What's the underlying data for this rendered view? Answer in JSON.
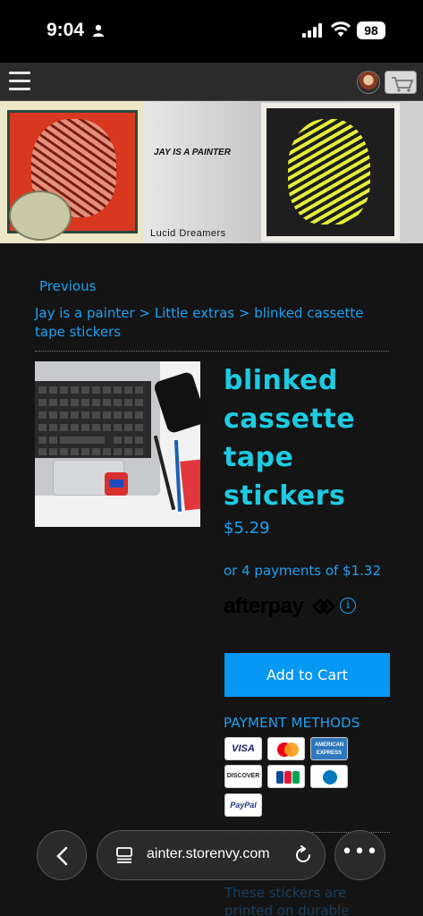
{
  "status_bar": {
    "time": "9:04",
    "battery": "98"
  },
  "banner": {
    "title": "JAY IS A PAINTER",
    "subtitle": "Lucid  Dreamers"
  },
  "navigation": {
    "previous_label": "Previous",
    "breadcrumb": "Jay is a painter > Little extras > blinked cassette tape stickers"
  },
  "product": {
    "title": "blinked cassette tape stickers",
    "price": "$5.29",
    "installments_text": "or 4 payments of $1.32",
    "afterpay_logo": "afterpay",
    "add_to_cart_label": "Add to Cart",
    "payment_methods_label": "PAYMENT METHODS",
    "payment_methods": [
      {
        "name": "visa",
        "label": "VISA"
      },
      {
        "name": "mastercard",
        "label": "MasterCard"
      },
      {
        "name": "amex",
        "label": "AMERICAN EXPRESS"
      },
      {
        "name": "discover",
        "label": "DISCOVER"
      },
      {
        "name": "jcb",
        "label": "JCB"
      },
      {
        "name": "diners",
        "label": "Diners Club"
      },
      {
        "name": "paypal",
        "label": "PayPal"
      }
    ],
    "description": "These stickers are printed on durable"
  },
  "browser": {
    "url": "ainter.storenvy.com",
    "more_label": "•••"
  },
  "colors": {
    "link": "#1da1f2",
    "title": "#1ecbe1",
    "button": "#0797f5",
    "background": "#141414"
  }
}
